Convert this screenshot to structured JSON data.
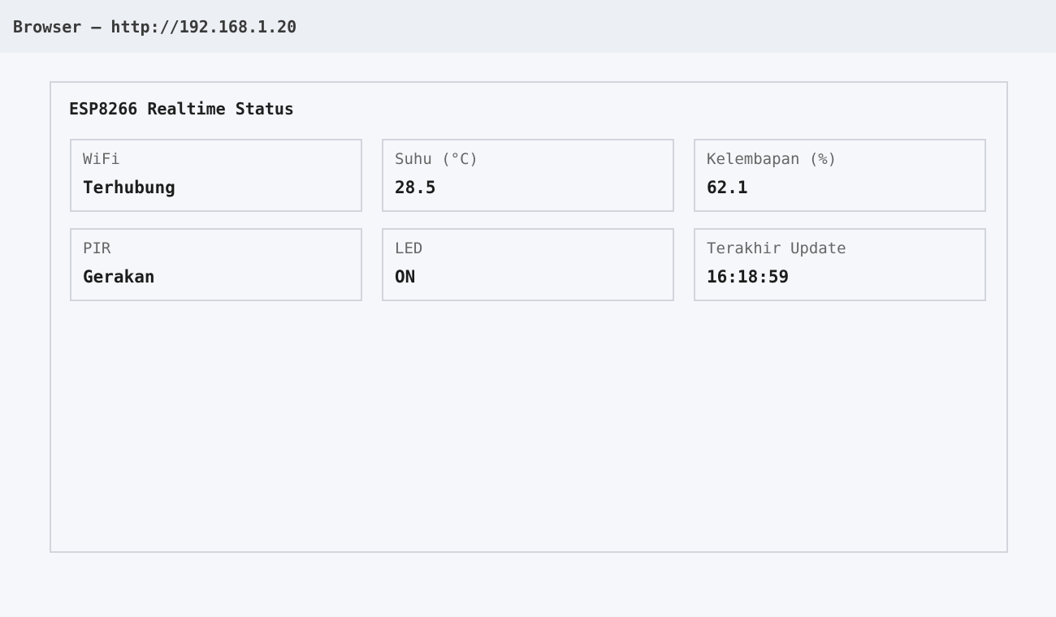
{
  "browser": {
    "title": "Browser — http://192.168.1.20"
  },
  "panel": {
    "title": "ESP8266 Realtime Status",
    "cards": [
      {
        "label": "WiFi",
        "value": "Terhubung"
      },
      {
        "label": "Suhu (°C)",
        "value": "28.5"
      },
      {
        "label": "Kelembapan (%)",
        "value": "62.1"
      },
      {
        "label": "PIR",
        "value": "Gerakan"
      },
      {
        "label": "LED",
        "value": "ON"
      },
      {
        "label": "Terakhir Update",
        "value": "16:18:59"
      }
    ]
  }
}
